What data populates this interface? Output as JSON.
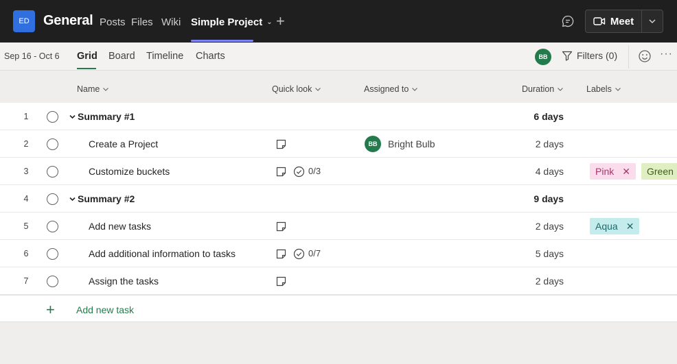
{
  "app": {
    "team_initials": "ED",
    "team_name": "General",
    "tabs": [
      {
        "label": "Posts"
      },
      {
        "label": "Files"
      },
      {
        "label": "Wiki"
      },
      {
        "label": "Simple Project",
        "active": true
      }
    ],
    "meet_label": "Meet"
  },
  "toolbar": {
    "date_range": "Sep 16 - Oct 6",
    "views": [
      "Grid",
      "Board",
      "Timeline",
      "Charts"
    ],
    "active_view": "Grid",
    "user_initials": "BB",
    "filters_label": "Filters (0)"
  },
  "columns": {
    "name": "Name",
    "quick_look": "Quick look",
    "assigned_to": "Assigned to",
    "duration": "Duration",
    "labels": "Labels"
  },
  "rows": [
    {
      "num": "1",
      "name": "Summary #1",
      "summary": true,
      "duration": "6 days"
    },
    {
      "num": "2",
      "name": "Create a Project",
      "note": true,
      "assignee_initials": "BB",
      "assignee": "Bright Bulb",
      "duration": "2 days"
    },
    {
      "num": "3",
      "name": "Customize buckets",
      "note": true,
      "checklist": "0/3",
      "duration": "4 days",
      "labels": [
        {
          "text": "Pink",
          "color": "#fbdcec",
          "fg": "#a4376b"
        },
        {
          "text": "Green",
          "color": "#dfeec3",
          "fg": "#3f5e18"
        }
      ]
    },
    {
      "num": "4",
      "name": "Summary #2",
      "summary": true,
      "duration": "9 days"
    },
    {
      "num": "5",
      "name": "Add new tasks",
      "note": true,
      "duration": "2 days",
      "labels": [
        {
          "text": "Aqua",
          "color": "#c5ecec",
          "fg": "#1f6a6a"
        }
      ]
    },
    {
      "num": "6",
      "name": "Add additional information to tasks",
      "note": true,
      "checklist": "0/7",
      "duration": "5 days"
    },
    {
      "num": "7",
      "name": "Assign the tasks",
      "note": true,
      "duration": "2 days"
    }
  ],
  "add_task_label": "Add new task",
  "colors": {
    "accent": "#237b4b",
    "topbar": "#1f1f1f",
    "tab_underline": "#7f85f5",
    "team_avatar": "#2f6fe0"
  }
}
